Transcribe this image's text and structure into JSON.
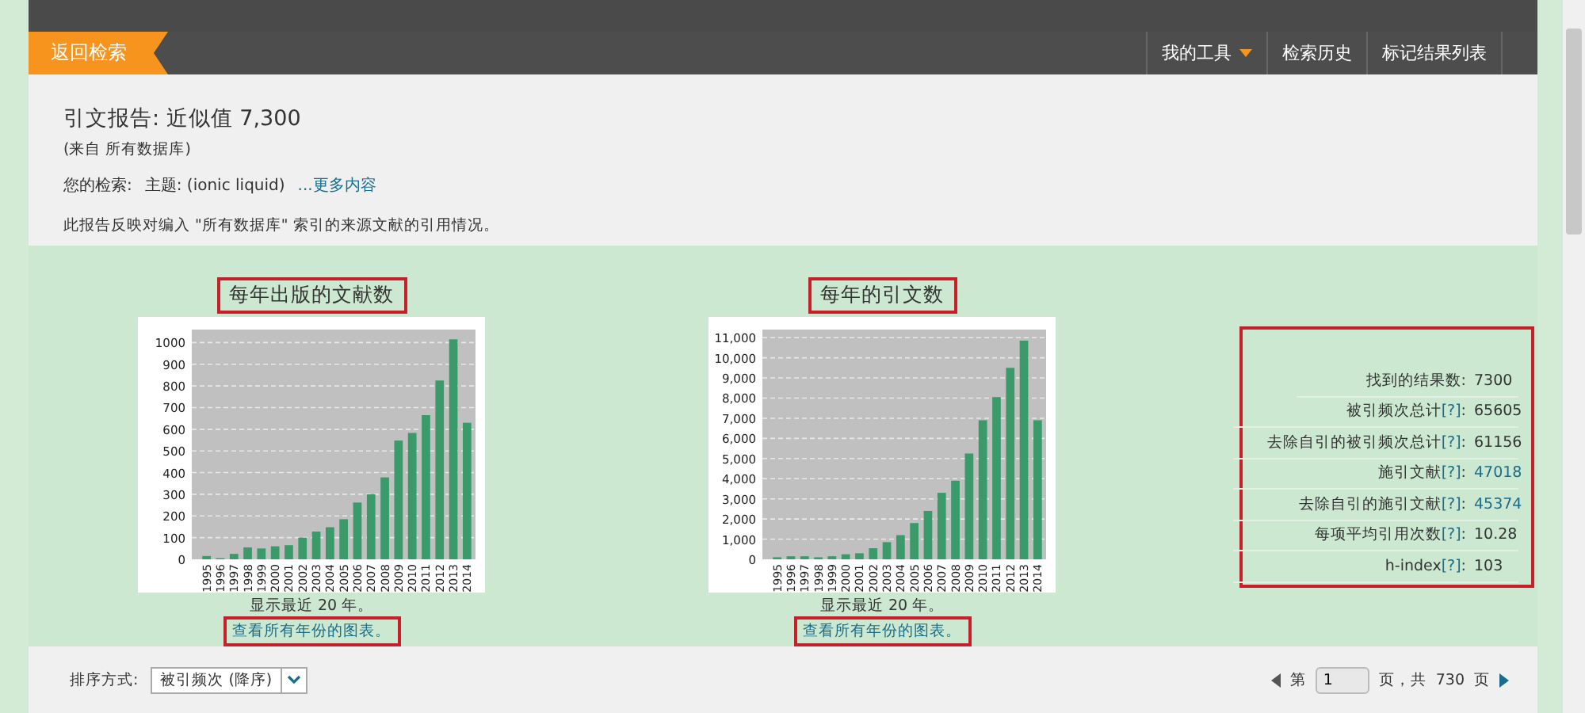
{
  "nav": {
    "back": "返回检索",
    "items": [
      {
        "label": "我的工具",
        "dropdown": true
      },
      {
        "label": "检索历史",
        "dropdown": false
      },
      {
        "label": "标记结果列表",
        "dropdown": false
      }
    ]
  },
  "header": {
    "title": "引文报告: 近似值 7,300",
    "source": "(来自 所有数据库)",
    "query_label": "您的检索:",
    "query": "主题: (ionic liquid)",
    "more_link": "...更多内容",
    "note": "此报告反映对编入 \"所有数据库\" 索引的来源文献的引用情况。"
  },
  "charts": [
    {
      "title": "每年出版的文献数",
      "caption": "显示最近 20 年。",
      "link": "查看所有年份的图表。",
      "chart_data": {
        "type": "bar",
        "categories": [
          "1995",
          "1996",
          "1997",
          "1998",
          "1999",
          "2000",
          "2001",
          "2002",
          "2003",
          "2004",
          "2005",
          "2006",
          "2007",
          "2008",
          "2009",
          "2010",
          "2011",
          "2012",
          "2013",
          "2014"
        ],
        "grid": true,
        "series": [
          {
            "color": "#3a9a6a",
            "values": [
              15,
              5,
              25,
              55,
              50,
              60,
              65,
              100,
              128,
              148,
              185,
              262,
              300,
              378,
              548,
              583,
              665,
              825,
              1015,
              630
            ]
          }
        ],
        "ylim": [
          0,
          1060
        ],
        "yticks": [
          0,
          100,
          200,
          300,
          400,
          500,
          600,
          700,
          800,
          900,
          1000
        ]
      }
    },
    {
      "title": "每年的引文数",
      "caption": "显示最近 20 年。",
      "link": "查看所有年份的图表。",
      "chart_data": {
        "type": "bar",
        "categories": [
          "1995",
          "1996",
          "1997",
          "1998",
          "1999",
          "2000",
          "2001",
          "2002",
          "2003",
          "2004",
          "2005",
          "2006",
          "2007",
          "2008",
          "2009",
          "2010",
          "2011",
          "2012",
          "2013",
          "2014"
        ],
        "grid": true,
        "series": [
          {
            "color": "#3a9a6a",
            "values": [
              100,
              150,
              150,
              100,
              150,
              250,
              300,
              550,
              850,
              1200,
              1800,
              2400,
              3300,
              3900,
              5250,
              6900,
              8050,
              9500,
              10850,
              6900
            ]
          }
        ],
        "ylim": [
          0,
          11400
        ],
        "yticks": [
          {
            "value": 0,
            "label": "0"
          },
          {
            "value": 1000,
            "label": "1,000"
          },
          {
            "value": 2000,
            "label": "2,000"
          },
          {
            "value": 3000,
            "label": "3,000"
          },
          {
            "value": 4000,
            "label": "4,000"
          },
          {
            "value": 5000,
            "label": "5,000"
          },
          {
            "value": 6000,
            "label": "6,000"
          },
          {
            "value": 7000,
            "label": "7,000"
          },
          {
            "value": 8000,
            "label": "8,000"
          },
          {
            "value": 9000,
            "label": "9,000"
          },
          {
            "value": 10000,
            "label": "10,000"
          },
          {
            "value": 11000,
            "label": "11,000"
          }
        ]
      }
    }
  ],
  "stats": [
    {
      "label": "找到的结果数:",
      "value": "7300",
      "linked": false
    },
    {
      "label": "被引频次总计",
      "help": "[?]",
      "colon": ":",
      "value": "65605",
      "linked": false
    },
    {
      "label": "去除自引的被引频次总计",
      "help": "[?]",
      "colon": ":",
      "value": "61156",
      "linked": false
    },
    {
      "label": "施引文献",
      "help": "[?]",
      "colon": ":",
      "value": "47018",
      "linked": true
    },
    {
      "label": "去除自引的施引文献",
      "help": "[?]",
      "colon": ":",
      "value": "45374",
      "linked": true
    },
    {
      "label": "每项平均引用次数",
      "help": "[?]",
      "colon": ":",
      "value": "10.28",
      "linked": false
    },
    {
      "label": "h-index",
      "help": "[?]",
      "colon": ":",
      "value": "103",
      "linked": false
    }
  ],
  "sort": {
    "label": "排序方式:",
    "value": "被引频次 (降序)"
  },
  "pager": {
    "prefix": "第",
    "page": "1",
    "middle": "页，共",
    "total": "730",
    "suffix": "页"
  }
}
